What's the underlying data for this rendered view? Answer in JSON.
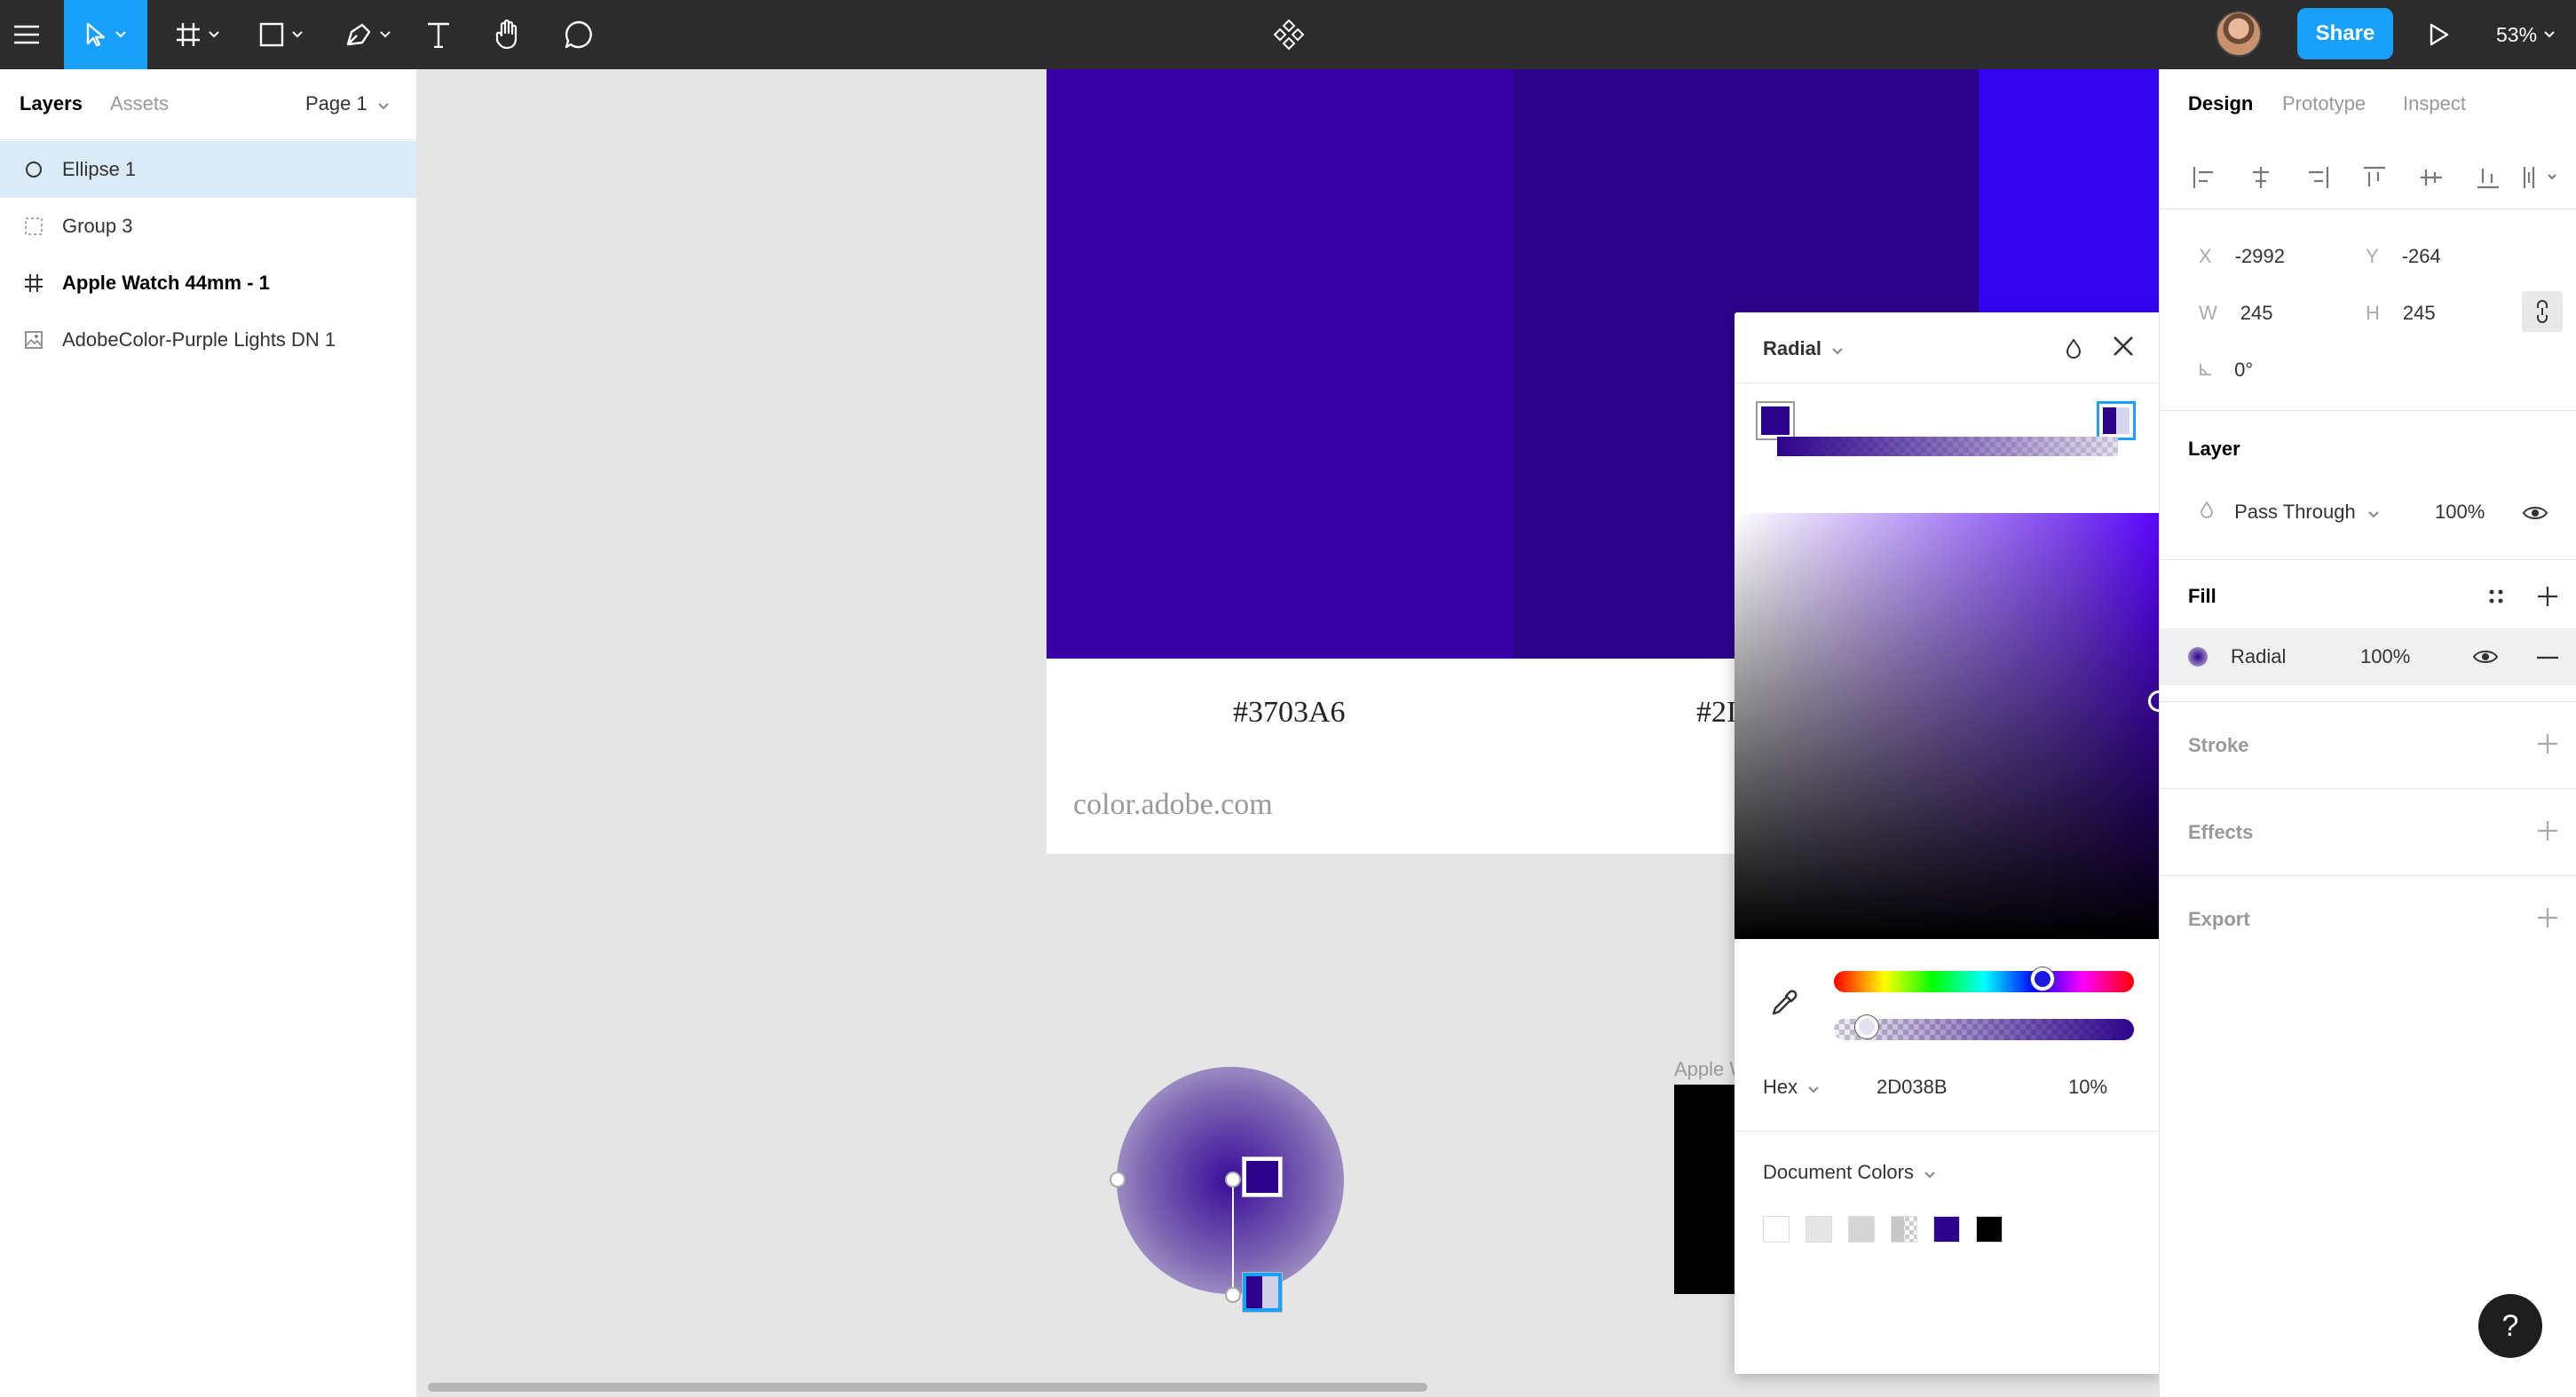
{
  "toolbar": {
    "share_label": "Share",
    "zoom": "53%"
  },
  "left_panel": {
    "tabs": [
      "Layers",
      "Assets"
    ],
    "page": "Page 1",
    "layers": [
      {
        "name": "Ellipse 1",
        "icon": "ellipse-icon",
        "selected": true
      },
      {
        "name": "Group 3",
        "icon": "group-icon"
      },
      {
        "name": "Apple Watch 44mm - 1",
        "icon": "frame-icon"
      },
      {
        "name": "AdobeColor-Purple Lights DN 1",
        "icon": "image-icon"
      }
    ]
  },
  "canvas": {
    "swatch_hex_1": "#3703A6",
    "swatch_hex_2": "#2I",
    "source": "color.adobe.com",
    "frame_label": "Apple W",
    "colors": {
      "swatch1": "#3703a6",
      "swatch2": "#2d038b",
      "swatch3": "#3304f0"
    }
  },
  "picker": {
    "type": "Radial",
    "mode": "Hex",
    "hex": "2D038B",
    "opacity": "10%",
    "document_colors_label": "Document Colors",
    "document_colors": [
      "#ffffff",
      "#e6e6e6",
      "#d6d6d6",
      "checker",
      "#2d038b",
      "#000000"
    ]
  },
  "right_panel": {
    "tabs": [
      "Design",
      "Prototype",
      "Inspect"
    ],
    "x_label": "X",
    "x": "-2992",
    "y_label": "Y",
    "y": "-264",
    "w_label": "W",
    "w": "245",
    "h_label": "H",
    "h": "245",
    "rotation": "0°",
    "layer_title": "Layer",
    "blend": "Pass Through",
    "layer_opacity": "100%",
    "fill_title": "Fill",
    "fill_type": "Radial",
    "fill_opacity": "100%",
    "stroke_title": "Stroke",
    "effects_title": "Effects",
    "export_title": "Export"
  },
  "help_label": "?"
}
